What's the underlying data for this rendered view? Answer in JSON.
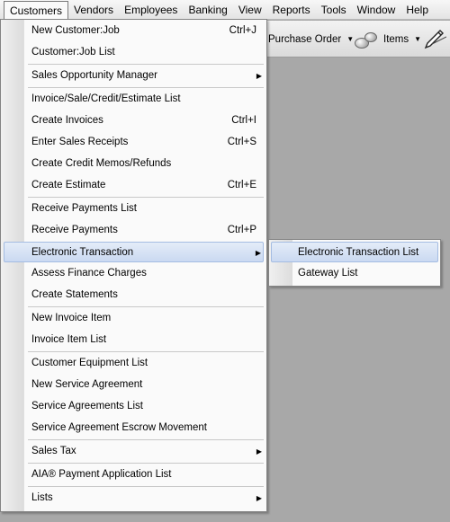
{
  "menubar": {
    "items": [
      "Customers",
      "Vendors",
      "Employees",
      "Banking",
      "View",
      "Reports",
      "Tools",
      "Window",
      "Help"
    ]
  },
  "toolbar": {
    "purchase_order_label": "Purchase Order",
    "items_label": "Items",
    "dropdown_glyph": "▼"
  },
  "customers_menu": {
    "items": [
      {
        "label": "New Customer:Job",
        "shortcut": "Ctrl+J"
      },
      {
        "label": "Customer:Job List",
        "shortcut": ""
      },
      {
        "label": "Sales Opportunity Manager",
        "shortcut": "",
        "submenu": true
      },
      {
        "label": "Invoice/Sale/Credit/Estimate List",
        "shortcut": ""
      },
      {
        "label": "Create Invoices",
        "shortcut": "Ctrl+I"
      },
      {
        "label": "Enter Sales Receipts",
        "shortcut": "Ctrl+S"
      },
      {
        "label": "Create Credit Memos/Refunds",
        "shortcut": ""
      },
      {
        "label": "Create Estimate",
        "shortcut": "Ctrl+E"
      },
      {
        "label": "Receive Payments List",
        "shortcut": ""
      },
      {
        "label": "Receive Payments",
        "shortcut": "Ctrl+P"
      },
      {
        "label": "Electronic Transaction",
        "shortcut": "",
        "submenu": true,
        "highlighted": true
      },
      {
        "label": "Assess Finance Charges",
        "shortcut": ""
      },
      {
        "label": "Create Statements",
        "shortcut": ""
      },
      {
        "label": "New Invoice Item",
        "shortcut": ""
      },
      {
        "label": "Invoice Item List",
        "shortcut": ""
      },
      {
        "label": "Customer Equipment List",
        "shortcut": ""
      },
      {
        "label": "New Service Agreement",
        "shortcut": ""
      },
      {
        "label": "Service Agreements List",
        "shortcut": ""
      },
      {
        "label": "Service Agreement Escrow Movement",
        "shortcut": ""
      },
      {
        "label": "Sales Tax",
        "shortcut": "",
        "submenu": true
      },
      {
        "label": "AIA® Payment Application List",
        "shortcut": ""
      },
      {
        "label": "Lists",
        "shortcut": "",
        "submenu": true
      }
    ],
    "submenu_glyph": "▶"
  },
  "electronic_transaction_submenu": {
    "items": [
      {
        "label": "Electronic Transaction List",
        "highlighted": true
      },
      {
        "label": "Gateway List"
      }
    ]
  },
  "colors": {
    "highlight_border": "#a4bce2",
    "highlight_fill": "#cad9f1",
    "desktop": "#a8a8a8"
  }
}
